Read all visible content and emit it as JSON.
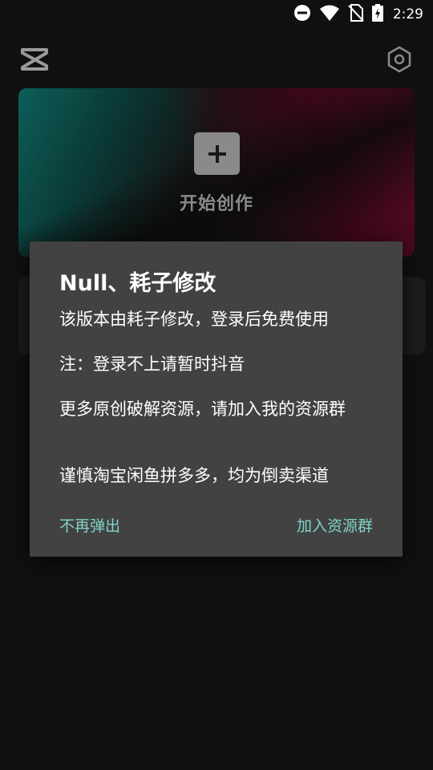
{
  "status_bar": {
    "time": "2:29",
    "icons": [
      "do-not-disturb-icon",
      "wifi-icon",
      "no-sim-icon",
      "battery-charging-icon"
    ]
  },
  "header": {
    "logo": "capcut-logo-icon",
    "settings_icon": "settings-hexagon-icon"
  },
  "create_card": {
    "label": "开始创作",
    "icon": "plus-icon",
    "colors": {
      "teal": "#0d5e58",
      "red": "#5a0b22"
    }
  },
  "dialog": {
    "title": "Null、耗子修改",
    "lines": [
      "该版本由耗子修改，登录后免费使用",
      "注：登录不上请暂时抖音",
      "更多原创破解资源，请加入我的资源群",
      "谨慎淘宝闲鱼拼多多，均为倒卖渠道"
    ],
    "buttons": {
      "dismiss": "不再弹出",
      "join": "加入资源群"
    },
    "colors": {
      "background": "#424242",
      "accent": "#7fd3c7"
    }
  }
}
